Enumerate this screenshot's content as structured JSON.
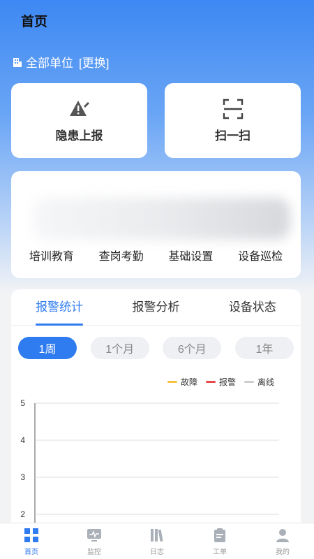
{
  "header": {
    "title": "首页"
  },
  "unit": {
    "label": "全部单位",
    "change": "[更换]"
  },
  "quick_actions": [
    {
      "label": "隐患上报",
      "icon": "warning-pen-icon"
    },
    {
      "label": "扫一扫",
      "icon": "scan-icon"
    }
  ],
  "menu": [
    "培训教育",
    "查岗考勤",
    "基础设置",
    "设备巡检"
  ],
  "stats": {
    "tabs": [
      "报警统计",
      "报警分析",
      "设备状态"
    ],
    "periods": [
      "1周",
      "1个月",
      "6个月",
      "1年"
    ]
  },
  "chart_data": {
    "type": "line",
    "series": [
      {
        "name": "故障",
        "color": "#f5c242",
        "values": []
      },
      {
        "name": "报警",
        "color": "#e94b4b",
        "values": []
      },
      {
        "name": "离线",
        "color": "#cccccc",
        "values": []
      }
    ],
    "yticks": [
      "5",
      "4",
      "3",
      "2"
    ],
    "ylim": [
      1,
      5
    ],
    "grid": true,
    "legend": "top-right"
  },
  "tabbar": [
    {
      "label": "首页",
      "icon": "home-grid-icon",
      "active": true
    },
    {
      "label": "监控",
      "icon": "monitor-icon",
      "active": false
    },
    {
      "label": "日志",
      "icon": "log-books-icon",
      "active": false
    },
    {
      "label": "工单",
      "icon": "work-order-icon",
      "active": false
    },
    {
      "label": "我的",
      "icon": "user-icon",
      "active": false
    }
  ]
}
